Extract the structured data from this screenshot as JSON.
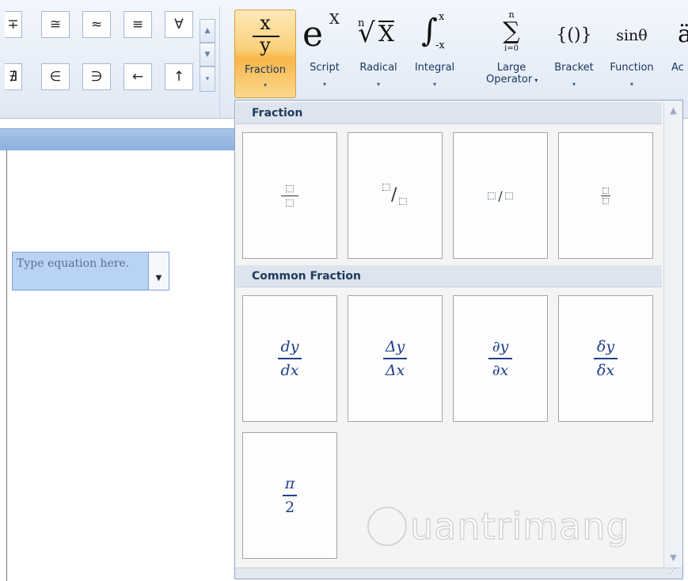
{
  "symbols": {
    "row1": [
      "∓",
      "≅",
      "≈",
      "≡",
      "∀"
    ],
    "row2": [
      "∄",
      "∈",
      "∋",
      "←",
      "↑"
    ],
    "scroll_up": "▲",
    "scroll_down": "▼",
    "scroll_more": "▾"
  },
  "tools": {
    "fraction": {
      "label": "Fraction",
      "num": "x",
      "den": "y"
    },
    "script": {
      "label": "Script",
      "base": "e",
      "sup": "X"
    },
    "radical": {
      "label": "Radical",
      "index": "n",
      "radicand": "X"
    },
    "integral": {
      "label": "Integral",
      "upper": "x",
      "lower": "-x"
    },
    "large_operator": {
      "label_line1": "Large",
      "label_line2": "Operator",
      "upper": "n",
      "lower": "i=0"
    },
    "bracket": {
      "label": "Bracket",
      "glyph": "{()}"
    },
    "function": {
      "label": "Function",
      "glyph": "sinθ"
    },
    "accent": {
      "label": "Ac"
    },
    "arrow": "▾"
  },
  "equation": {
    "placeholder": "Type equation here.",
    "dropdown": "▼"
  },
  "gallery": {
    "fraction_header": "Fraction",
    "common_header": "Common Fraction",
    "fraction_tiles": [
      {
        "type": "stacked"
      },
      {
        "type": "skewed",
        "slash": "/"
      },
      {
        "type": "linear",
        "slash": "/"
      },
      {
        "type": "small"
      }
    ],
    "common_tiles": [
      {
        "num": "dy",
        "den": "dx"
      },
      {
        "num": "Δy",
        "den": "Δx"
      },
      {
        "num": "∂y",
        "den": "∂x"
      },
      {
        "num": "δy",
        "den": "δx"
      },
      {
        "num": "π",
        "den": "2"
      }
    ],
    "scroll_up": "▲",
    "scroll_down": "▼",
    "grip": "⋰"
  },
  "watermark": "uantrimang"
}
